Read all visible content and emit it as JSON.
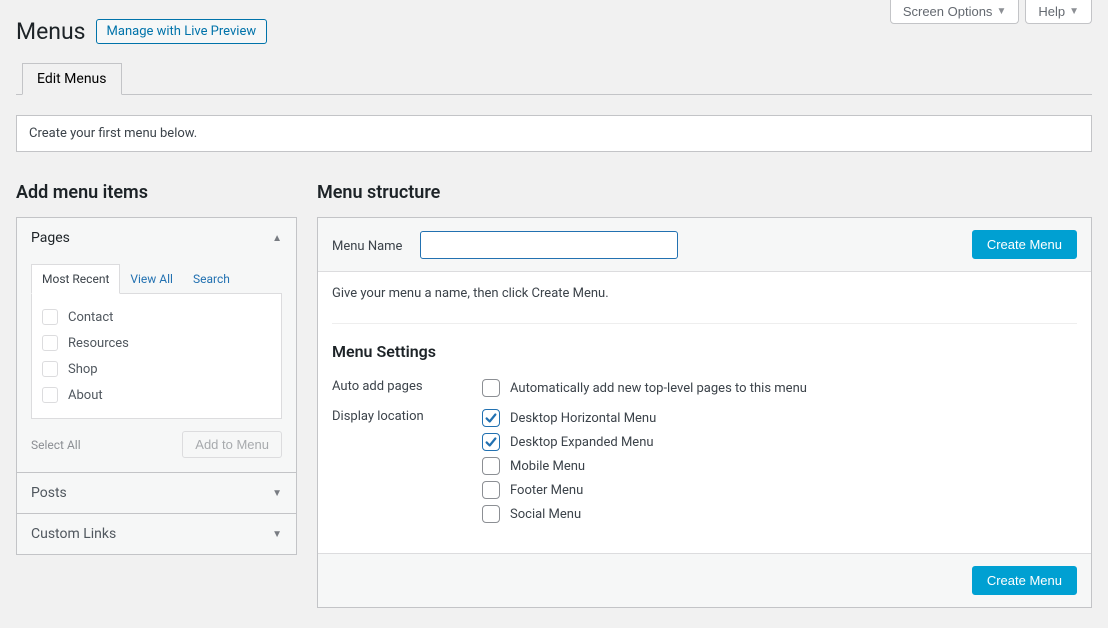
{
  "top_tabs": {
    "screen_options": "Screen Options",
    "help": "Help"
  },
  "header": {
    "title": "Menus",
    "live_preview": "Manage with Live Preview"
  },
  "nav_tabs": {
    "edit_menus": "Edit Menus"
  },
  "notice": "Create your first menu below.",
  "left": {
    "heading": "Add menu items",
    "panels": {
      "pages": {
        "title": "Pages",
        "subtabs": {
          "most_recent": "Most Recent",
          "view_all": "View All",
          "search": "Search"
        },
        "items": [
          "Contact",
          "Resources",
          "Shop",
          "About"
        ],
        "select_all": "Select All",
        "add_to_menu": "Add to Menu"
      },
      "posts": {
        "title": "Posts"
      },
      "custom_links": {
        "title": "Custom Links"
      }
    }
  },
  "right": {
    "heading": "Menu structure",
    "menu_name_label": "Menu Name",
    "menu_name_value": "",
    "create_menu": "Create Menu",
    "instructions": "Give your menu a name, then click Create Menu.",
    "settings_heading": "Menu Settings",
    "auto_add_label": "Auto add pages",
    "auto_add_option": "Automatically add new top-level pages to this menu",
    "display_location_label": "Display location",
    "locations": [
      {
        "label": "Desktop Horizontal Menu",
        "checked": true
      },
      {
        "label": "Desktop Expanded Menu",
        "checked": true
      },
      {
        "label": "Mobile Menu",
        "checked": false
      },
      {
        "label": "Footer Menu",
        "checked": false
      },
      {
        "label": "Social Menu",
        "checked": false
      }
    ]
  }
}
